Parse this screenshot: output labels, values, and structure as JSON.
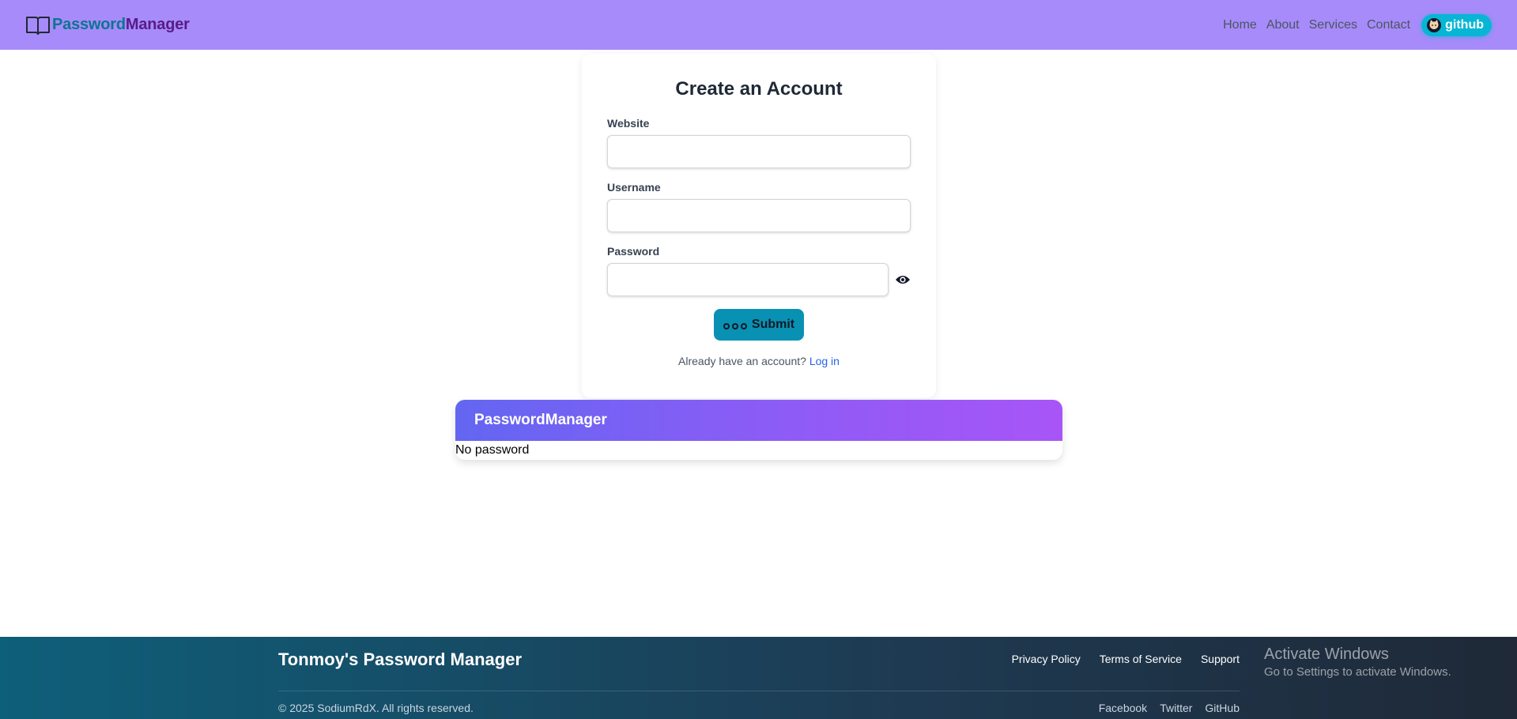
{
  "navbar": {
    "brand_part1": "Password",
    "brand_part2": "Manager",
    "brand_icon": "book-open-icon",
    "links": [
      "Home",
      "About",
      "Services",
      "Contact"
    ],
    "github_label": "github",
    "github_icon": "github-icon",
    "bg_color": "#a78bfa"
  },
  "form": {
    "title": "Create an Account",
    "website_label": "Website",
    "website_value": "",
    "username_label": "Username",
    "username_value": "",
    "password_label": "Password",
    "password_value": "",
    "password_toggle_icon": "eye-icon",
    "submit_label": "Submit",
    "submit_icon": "dots-icon",
    "login_prompt": "Already have an account?",
    "login_link": "Log in"
  },
  "passwords_panel": {
    "title": "PasswordManager",
    "empty_text": "No password"
  },
  "footer": {
    "title": "Tonmoy's Password Manager",
    "top_links": [
      "Privacy Policy",
      "Terms of Service",
      "Support"
    ],
    "copyright": "© 2025 SodiumRdX. All rights reserved.",
    "bottom_links": [
      "Facebook",
      "Twitter",
      "GitHub"
    ]
  },
  "watermark": {
    "title": "Activate Windows",
    "subtitle": "Go to Settings to activate Windows."
  },
  "colors": {
    "accent_cyan": "#06b6d4",
    "submit_bg": "#0891b2",
    "link_blue": "#2563eb"
  }
}
